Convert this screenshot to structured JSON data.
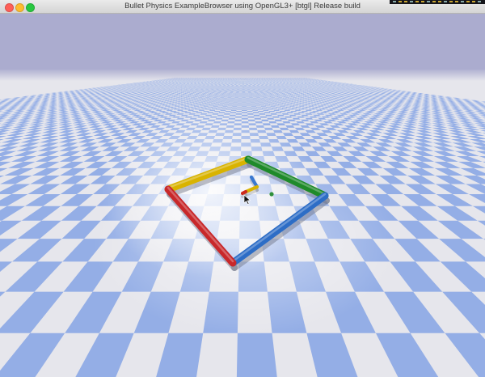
{
  "window": {
    "title": "Bullet Physics ExampleBrowser using OpenGL3+ [btgl] Release build",
    "buttons": [
      {
        "name": "close",
        "color": "#ff5f57"
      },
      {
        "name": "minimize",
        "color": "#febc2e"
      },
      {
        "name": "zoom",
        "color": "#28c840"
      }
    ]
  },
  "scene": {
    "sky_color": "#abaccf",
    "floor_light": "#e6e6ec",
    "floor_dark": "#94aee6",
    "walls": [
      {
        "name": "yellow-wall",
        "color": "#d9b300"
      },
      {
        "name": "green-wall",
        "color": "#1f8a2a"
      },
      {
        "name": "blue-wall",
        "color": "#2d6dc6"
      },
      {
        "name": "red-wall",
        "color": "#c8282a"
      }
    ],
    "snake_segments": [
      {
        "name": "snake-head",
        "color": "#3a78d0"
      },
      {
        "name": "snake-body",
        "color": "#d9b300"
      },
      {
        "name": "snake-tail",
        "color": "#cc2a1c"
      }
    ],
    "food_color": "#2e8f3a"
  }
}
